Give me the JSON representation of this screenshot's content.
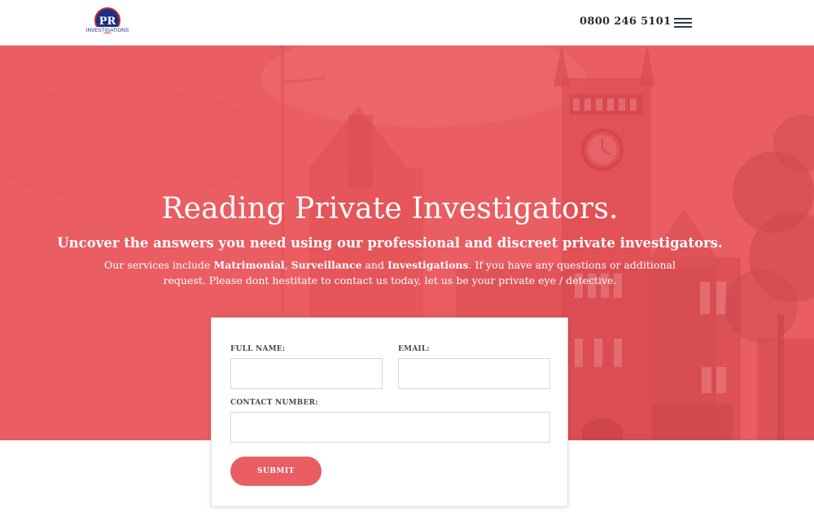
{
  "header": {
    "logo": {
      "initials": "PR",
      "company": "INVESTIGATIONS",
      "icon": "pr-investigations-logo"
    },
    "phone": "0800 246 5101",
    "menu_icon": "hamburger-menu-icon"
  },
  "hero": {
    "title": "Reading Private Investigators.",
    "subtitle": "Uncover the answers you need using our professional and discreet private investigators.",
    "description": {
      "intro": "Our services include ",
      "service_1": "Matrimonial",
      "sep_1": ", ",
      "service_2": "Surveillance",
      "sep_2": " and ",
      "service_3": "Investigations",
      "outro": ". If you have any questions or additional request. Please dont hestitate to contact us today, let us be your private eye / detective."
    },
    "overlay_color": "#ea5d62",
    "background": "clock-tower-building-photo"
  },
  "form": {
    "full_name": {
      "label": "FULL NAME:",
      "value": "",
      "placeholder": ""
    },
    "email": {
      "label": "EMAIL:",
      "value": "",
      "placeholder": ""
    },
    "contact_number": {
      "label": "CONTACT NUMBER:",
      "value": "",
      "placeholder": ""
    },
    "submit_label": "SUBMIT",
    "accent_color": "#ea5d62"
  }
}
